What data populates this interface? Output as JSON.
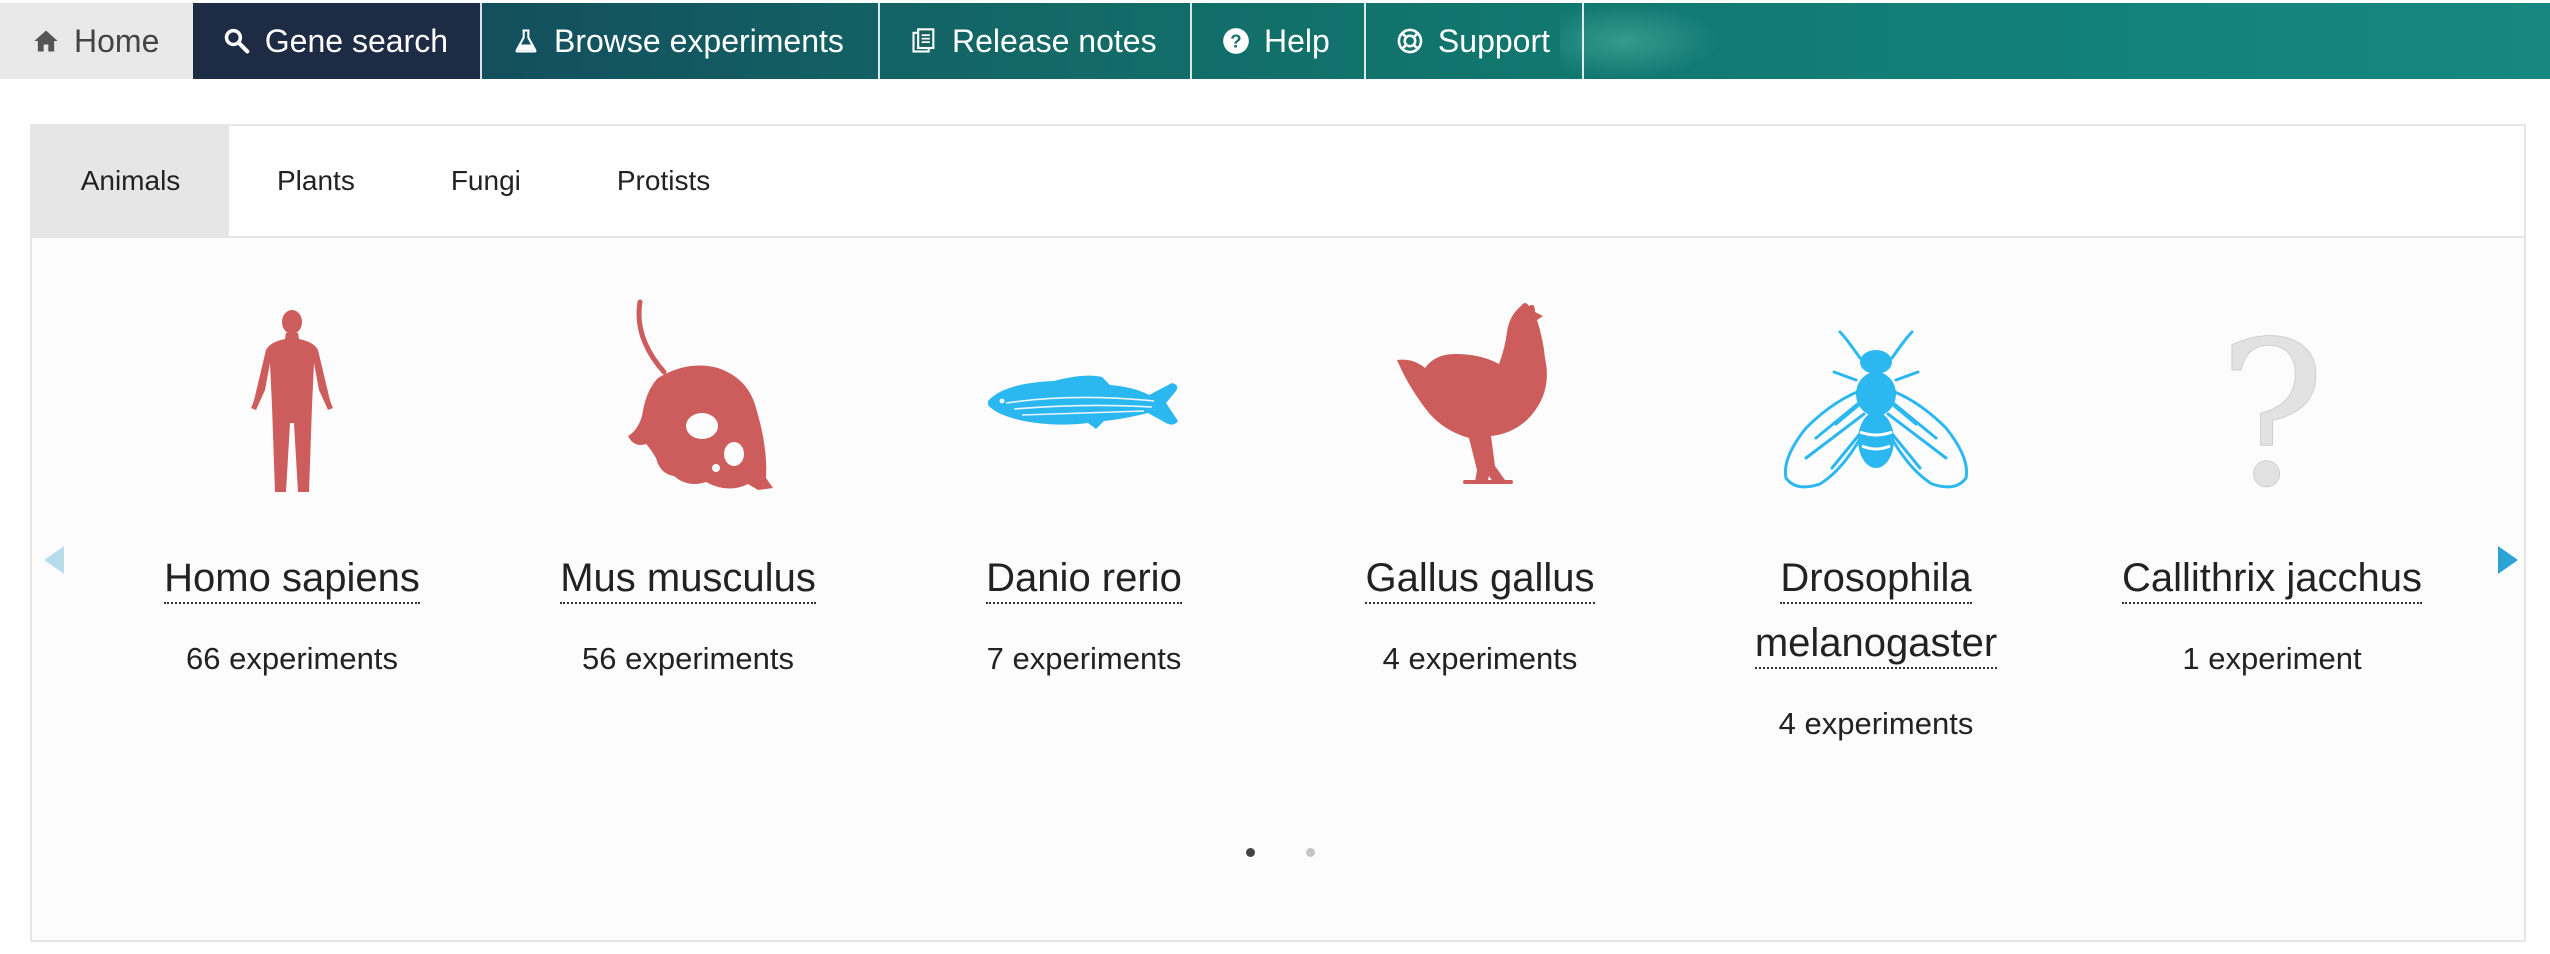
{
  "nav": {
    "home": "Home",
    "gene_search": "Gene search",
    "browse": "Browse experiments",
    "release": "Release notes",
    "help": "Help",
    "support": "Support"
  },
  "tabs": [
    "Animals",
    "Plants",
    "Fungi",
    "Protists"
  ],
  "species": [
    {
      "name": "Homo sapiens",
      "count": "66 experiments",
      "icon": "human-icon",
      "color": "#cd5c5c"
    },
    {
      "name": "Mus musculus",
      "count": "56 experiments",
      "icon": "mouse-icon",
      "color": "#cd5c5c"
    },
    {
      "name": "Danio rerio",
      "count": "7 experiments",
      "icon": "zebrafish-icon",
      "color": "#2bb7ef"
    },
    {
      "name": "Gallus gallus",
      "count": "4 experiments",
      "icon": "chicken-icon",
      "color": "#cd5c5c"
    },
    {
      "name": "Drosophila melanogaster",
      "count": "4 experiments",
      "icon": "fly-icon",
      "color": "#2bb7ef"
    },
    {
      "name": "Callithrix jacchus",
      "count": "1 experiment",
      "icon": "question-mark-icon",
      "color": "#e0e0e0"
    }
  ],
  "pager": {
    "pages": 2,
    "current": 1
  }
}
